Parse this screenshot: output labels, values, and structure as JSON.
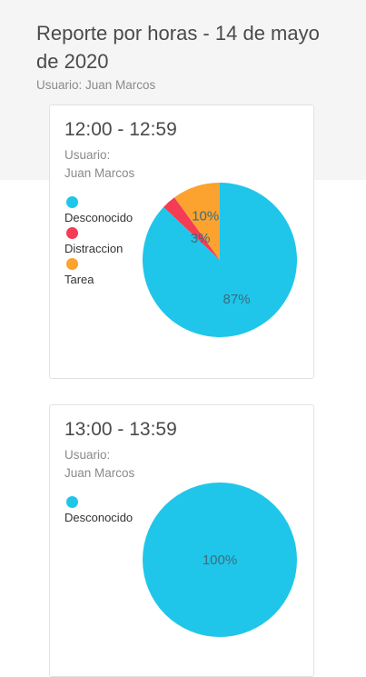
{
  "report": {
    "title": "Reporte por horas - 14 de mayo de 2020",
    "user": "Usuario: Juan Marcos"
  },
  "colors": {
    "desconocido": "#1fc6ea",
    "distraccion": "#f53c55",
    "tarea": "#fba22f"
  },
  "cards": [
    {
      "time_range": "12:00 - 12:59",
      "user_label": "Usuario:",
      "user_name": "Juan Marcos",
      "legend": [
        "Desconocido",
        "Distraccion",
        "Tarea"
      ],
      "slices": [
        {
          "category": "Desconocido",
          "percent": 87,
          "label": "87%"
        },
        {
          "category": "Distraccion",
          "percent": 3,
          "label": "3%"
        },
        {
          "category": "Tarea",
          "percent": 10,
          "label": "10%"
        }
      ]
    },
    {
      "time_range": "13:00 - 13:59",
      "user_label": "Usuario:",
      "user_name": "Juan Marcos",
      "legend": [
        "Desconocido"
      ],
      "slices": [
        {
          "category": "Desconocido",
          "percent": 100,
          "label": "100%"
        }
      ]
    }
  ]
}
